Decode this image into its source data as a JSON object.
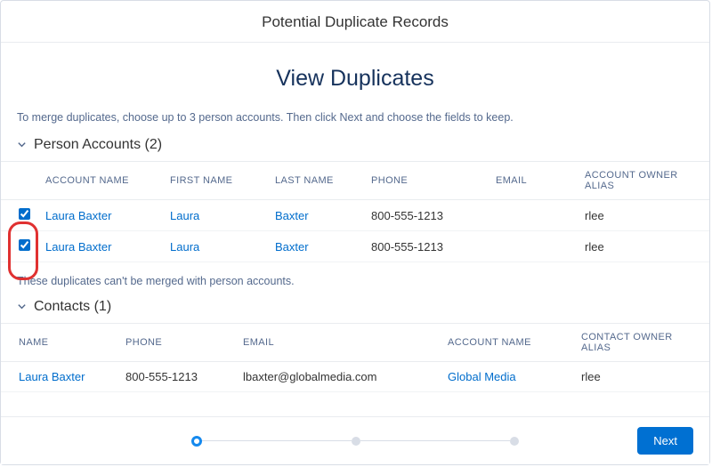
{
  "header": {
    "title": "Potential Duplicate Records"
  },
  "page": {
    "title": "View Duplicates"
  },
  "instructions": "To merge duplicates, choose up to 3 person accounts. Then click Next and choose the fields to keep.",
  "person_accounts": {
    "label": "Person Accounts (2)",
    "columns": {
      "name": "ACCOUNT NAME",
      "first": "FIRST NAME",
      "last": "LAST NAME",
      "phone": "PHONE",
      "email": "EMAIL",
      "owner": "ACCOUNT OWNER ALIAS"
    },
    "rows": [
      {
        "name": "Laura Baxter",
        "first": "Laura",
        "last": "Baxter",
        "phone": "800-555-1213",
        "email": "",
        "owner": "rlee"
      },
      {
        "name": "Laura Baxter",
        "first": "Laura",
        "last": "Baxter",
        "phone": "800-555-1213",
        "email": "",
        "owner": "rlee"
      }
    ]
  },
  "note": "These duplicates can't be merged with person accounts.",
  "contacts": {
    "label": "Contacts (1)",
    "columns": {
      "name": "NAME",
      "phone": "PHONE",
      "email": "EMAIL",
      "account": "ACCOUNT NAME",
      "owner": "CONTACT OWNER ALIAS"
    },
    "rows": [
      {
        "name": "Laura Baxter",
        "phone": "800-555-1213",
        "email": "lbaxter@globalmedia.com",
        "account": "Global Media",
        "owner": "rlee"
      }
    ]
  },
  "footer": {
    "next": "Next"
  }
}
